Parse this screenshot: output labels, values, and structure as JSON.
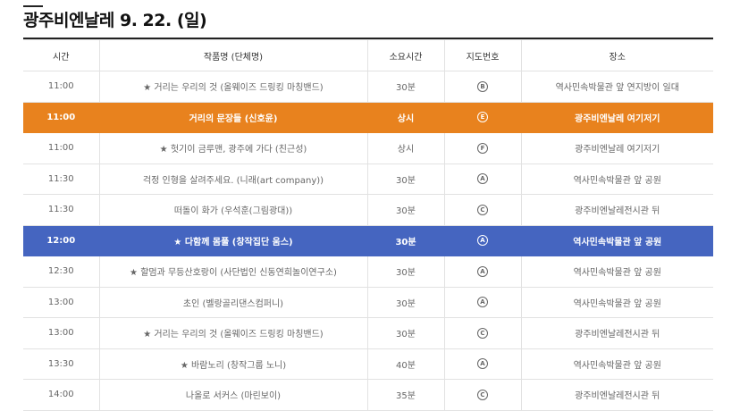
{
  "page": {
    "title": "광주비엔날레 9. 22. (일)"
  },
  "table": {
    "headers": [
      "시간",
      "작품명 (단체명)",
      "소요시간",
      "지도번호",
      "장소"
    ],
    "rows": [
      {
        "time": "11:00",
        "work": "★ 거리는 우리의 것 (올웨이즈 드링킹 마칭밴드)",
        "duration": "30분",
        "map": "B",
        "place": "역사민속박물관 앞 연지방이 일대",
        "highlight": ""
      },
      {
        "time": "11:00",
        "work": "거리의 문장들 (신호윤)",
        "duration": "상시",
        "map": "E",
        "place": "광주비엔날레 여기저기",
        "highlight": "orange"
      },
      {
        "time": "11:00",
        "work": "★ 헛기이 금루맨, 광주에 가다 (친근성)",
        "duration": "상시",
        "map": "F",
        "place": "광주비엔날레 여기저기",
        "highlight": ""
      },
      {
        "time": "11:30",
        "work": "걱정 인형을 살려주세요. (니래(art company))",
        "duration": "30분",
        "map": "A",
        "place": "역사민속박물관 앞 공원",
        "highlight": ""
      },
      {
        "time": "11:30",
        "work": "떠돌이 화가 (우석훈(그림광대))",
        "duration": "30분",
        "map": "C",
        "place": "광주비엔날레전시관 뒤",
        "highlight": ""
      },
      {
        "time": "12:00",
        "work": "★ 다함께 몸풀 (창작집단 움스)",
        "duration": "30분",
        "map": "A",
        "place": "역사민속박물관 앞 공원",
        "highlight": "blue"
      },
      {
        "time": "12:30",
        "work": "★ 할멈과 무등산호랑이 (사단법인 신동연희놀이연구소)",
        "duration": "30분",
        "map": "A",
        "place": "역사민속박물관 앞 공원",
        "highlight": ""
      },
      {
        "time": "13:00",
        "work": "초인 (벨랑골리댄스컴퍼니)",
        "duration": "30분",
        "map": "A",
        "place": "역사민속박물관 앞 공원",
        "highlight": ""
      },
      {
        "time": "13:00",
        "work": "★ 거리는 우리의 것 (올웨이즈 드링킹 마칭밴드)",
        "duration": "30분",
        "map": "C",
        "place": "광주비엔날레전시관 뒤",
        "highlight": ""
      },
      {
        "time": "13:30",
        "work": "★ 바람노리 (창작그룹 노니)",
        "duration": "40분",
        "map": "A",
        "place": "역사민속박물관 앞 공원",
        "highlight": ""
      },
      {
        "time": "14:00",
        "work": "나올로 서커스 (마린보이)",
        "duration": "35분",
        "map": "C",
        "place": "광주비엔날레전시관 뒤",
        "highlight": ""
      }
    ]
  },
  "colors": {
    "orange_highlight": "#e8821e",
    "blue_highlight": "#4565c0",
    "header_rule": "#222222"
  }
}
